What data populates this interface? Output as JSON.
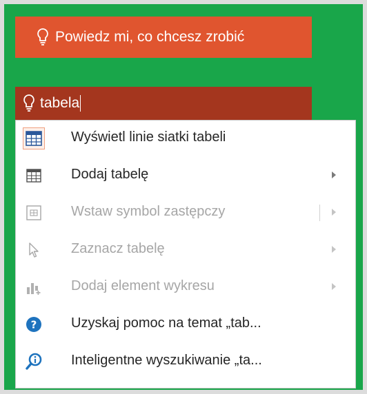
{
  "tell_me": {
    "icon": "lightbulb-icon",
    "label": "Powiedz mi, co chcesz zrobić",
    "color": "#e0552f"
  },
  "search": {
    "icon": "lightbulb-icon",
    "value": "tabela",
    "color": "#a4361e"
  },
  "frame_color": "#19a64a",
  "menu": {
    "items": [
      {
        "label": "Wyświetl linie siatki tabeli",
        "icon": "table-gridlines-icon",
        "enabled": true,
        "selected": true,
        "submenu": false
      },
      {
        "label": "Dodaj tabelę",
        "icon": "table-icon",
        "enabled": true,
        "selected": false,
        "submenu": true
      },
      {
        "label": "Wstaw symbol zastępczy",
        "icon": "placeholder-icon",
        "enabled": false,
        "selected": false,
        "submenu": true
      },
      {
        "label": "Zaznacz tabelę",
        "icon": "pointer-cursor-icon",
        "enabled": false,
        "selected": false,
        "submenu": true
      },
      {
        "label": "Dodaj element wykresu",
        "icon": "chart-element-icon",
        "enabled": false,
        "selected": false,
        "submenu": true
      },
      {
        "label": "Uzyskaj pomoc na temat „tab...",
        "icon": "help-icon",
        "enabled": true,
        "selected": false,
        "submenu": false
      },
      {
        "label": "Inteligentne wyszukiwanie „ta...",
        "icon": "smart-lookup-icon",
        "enabled": true,
        "selected": false,
        "submenu": false
      }
    ]
  }
}
